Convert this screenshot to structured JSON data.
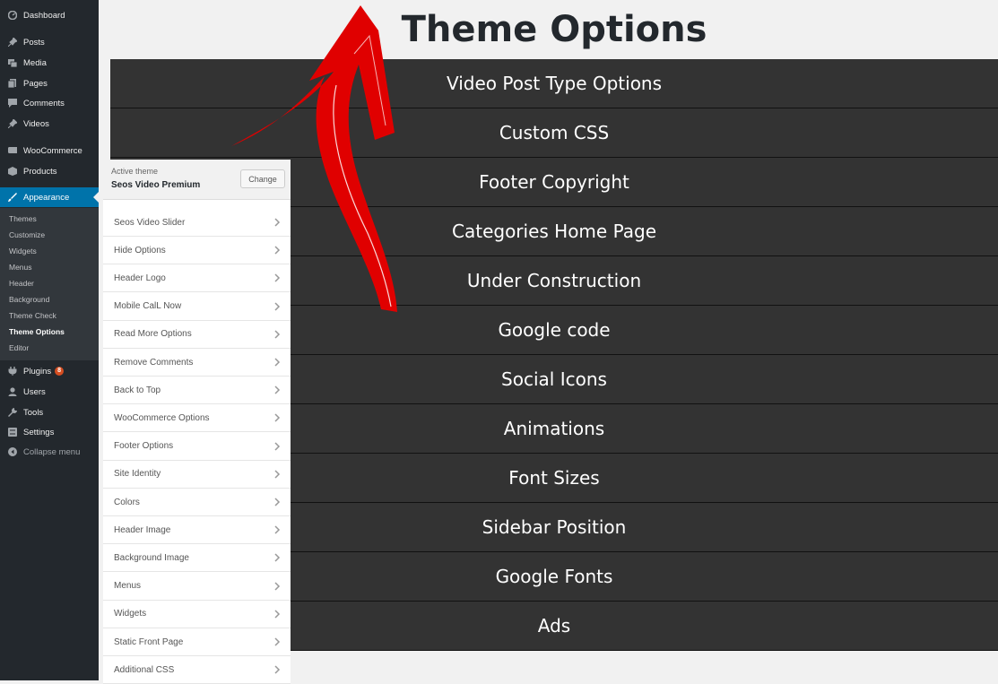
{
  "sidebar": {
    "items": [
      {
        "label": "Dashboard",
        "icon": "dashboard-icon"
      },
      {
        "label": "Posts",
        "icon": "pin-icon"
      },
      {
        "label": "Media",
        "icon": "media-icon"
      },
      {
        "label": "Pages",
        "icon": "page-icon"
      },
      {
        "label": "Comments",
        "icon": "comment-icon"
      },
      {
        "label": "Videos",
        "icon": "pin-icon"
      },
      {
        "label": "WooCommerce",
        "icon": "woo-icon"
      },
      {
        "label": "Products",
        "icon": "box-icon"
      },
      {
        "label": "Appearance",
        "icon": "brush-icon"
      },
      {
        "label": "Plugins",
        "icon": "plug-icon",
        "badge": "8"
      },
      {
        "label": "Users",
        "icon": "user-icon"
      },
      {
        "label": "Tools",
        "icon": "wrench-icon"
      },
      {
        "label": "Settings",
        "icon": "settings-icon"
      },
      {
        "label": "Collapse menu",
        "icon": "collapse-icon"
      }
    ],
    "appearance_submenu": [
      "Themes",
      "Customize",
      "Widgets",
      "Menus",
      "Header",
      "Background",
      "Theme Check",
      "Theme Options",
      "Editor"
    ]
  },
  "theme_options": {
    "title": "Theme Options",
    "rows": [
      "Video Post Type Options",
      "Custom CSS",
      "Footer Copyright",
      "Categories Home Page",
      "Under Construction",
      "Google code",
      "Social Icons",
      "Animations",
      "Font Sizes",
      "Sidebar Position",
      "Google Fonts",
      "Ads"
    ]
  },
  "customizer": {
    "active_label": "Active theme",
    "theme_name": "Seos Video Premium",
    "change_label": "Change",
    "sections": [
      "Seos Video Slider",
      "Hide Options",
      "Header Logo",
      "Mobile CalL Now",
      "Read More Options",
      "Remove Comments",
      "Back to Top",
      "WooCommerce Options",
      "Footer Options",
      "Site Identity",
      "Colors",
      "Header Image",
      "Background Image",
      "Menus",
      "Widgets",
      "Static Front Page",
      "Additional CSS"
    ]
  },
  "colors": {
    "accent": "#0073aa",
    "arrow": "#e00000",
    "option_bg": "#333333"
  }
}
